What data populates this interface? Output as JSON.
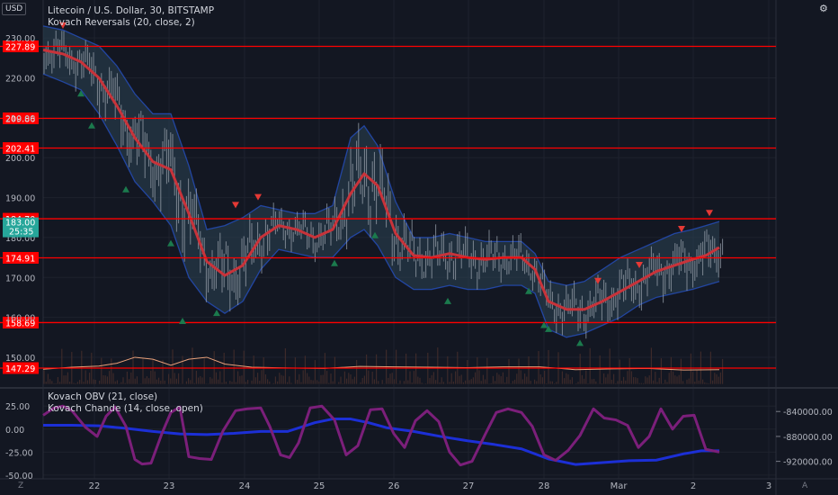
{
  "currency_badge": "USD",
  "title": "Litecoin / U.S. Dollar, 30, BITSTAMP",
  "indicators": {
    "reversals": "Kovach Reversals (20, close, 2)",
    "obv": "Kovach OBV (21, close)",
    "chande": "Kovach Chande (14, close, open)"
  },
  "corner_left": "Z",
  "corner_right": "A",
  "colors": {
    "background": "#131722",
    "grid": "#1e222d",
    "level_line": "#ff0000",
    "label_bg": "#ff0000",
    "ma_line": "#c8333a",
    "band_fill": "#2a4050",
    "band_edge": "#2962ff",
    "up_arrow": "#1b7a4d",
    "down_arrow": "#e53935",
    "obv_line": "#1c2fd6",
    "chande_line": "#7b1f7a",
    "price_tag": "#26a69a"
  },
  "chart_data": [
    {
      "type": "candlestick",
      "ylim": [
        143,
        235
      ],
      "xlim": [
        0,
        840
      ],
      "y_ticks": [
        150.0,
        160.0,
        170.0,
        180.0,
        190.0,
        200.0,
        210.0,
        220.0,
        230.0
      ],
      "y_tick_labels": [
        "150.00",
        "160.00",
        "170.00",
        "180.00",
        "190.00",
        "200.00",
        "210.00",
        "220.00",
        "230.00"
      ],
      "x_ticks": [
        105,
        188,
        272,
        355,
        438,
        521,
        605,
        688,
        771,
        855
      ],
      "x_tick_labels": [
        "22",
        "23",
        "24",
        "25",
        "26",
        "27",
        "28",
        "Mar",
        "2",
        "3"
      ],
      "horizontal_levels": [
        227.89,
        209.86,
        202.41,
        184.7,
        174.91,
        158.69,
        147.29
      ],
      "level_labels": [
        "227.89",
        "209.86",
        "202.41",
        "184.70",
        "174.91",
        "158.69",
        "147.29"
      ],
      "last_price": "183.00",
      "countdown": "25:35",
      "ma": {
        "x": [
          48,
          70,
          90,
          110,
          130,
          150,
          170,
          190,
          210,
          230,
          250,
          270,
          290,
          310,
          330,
          350,
          370,
          390,
          405,
          420,
          440,
          460,
          480,
          500,
          520,
          540,
          560,
          580,
          595,
          610,
          630,
          650,
          670,
          690,
          710,
          730,
          750,
          770,
          785,
          800
        ],
        "y": [
          227,
          226,
          224,
          220,
          213,
          205,
          199,
          197,
          186,
          174,
          170.5,
          173,
          180,
          183,
          182,
          180,
          182,
          191,
          196,
          193,
          181,
          175.5,
          175,
          176,
          175,
          174.5,
          175,
          175,
          172,
          164,
          162,
          162,
          164,
          166.5,
          169,
          171.5,
          173,
          174.5,
          175.5,
          177.5
        ]
      },
      "band": {
        "x": [
          48,
          70,
          90,
          110,
          130,
          150,
          170,
          190,
          210,
          230,
          250,
          270,
          290,
          310,
          330,
          350,
          370,
          390,
          405,
          420,
          440,
          460,
          480,
          500,
          520,
          540,
          560,
          580,
          595,
          610,
          630,
          650,
          670,
          690,
          710,
          730,
          750,
          770,
          785,
          800
        ],
        "upper": [
          233,
          232,
          230,
          228,
          223,
          216,
          211,
          211,
          198,
          182,
          183,
          185,
          188,
          187,
          186,
          186,
          188,
          205,
          208,
          203,
          189,
          180,
          180,
          181,
          180,
          179,
          179,
          179,
          176,
          169,
          168,
          169,
          172,
          175,
          177,
          179,
          181,
          182,
          183,
          184
        ],
        "lower": [
          221,
          219,
          217,
          211,
          203,
          194,
          189,
          183,
          170,
          164,
          161,
          164,
          172,
          177,
          176,
          175,
          175,
          180,
          182,
          178,
          170,
          167,
          167,
          168,
          167,
          167,
          168,
          168,
          166,
          157,
          155,
          156,
          158,
          160,
          163,
          165,
          166,
          167,
          168,
          169
        ]
      },
      "down_arrows": {
        "x": [
          70,
          262,
          287,
          665,
          711,
          758,
          789
        ],
        "y": [
          233,
          188,
          190,
          169,
          173,
          182,
          186
        ]
      },
      "up_arrows": {
        "x": [
          90,
          102,
          140,
          190,
          203,
          241,
          417,
          372,
          498,
          588,
          605,
          610,
          645
        ],
        "y": [
          216,
          208,
          192,
          178.5,
          159,
          161,
          180.5,
          173.5,
          164,
          166.5,
          158,
          157,
          153.5
        ]
      },
      "volume_line": {
        "x": [
          48,
          80,
          110,
          130,
          150,
          170,
          190,
          210,
          230,
          250,
          280,
          320,
          360,
          400,
          440,
          480,
          520,
          560,
          600,
          640,
          680,
          720,
          760,
          800
        ],
        "y": [
          147,
          147.5,
          147.8,
          148.5,
          150,
          149.5,
          148,
          149.5,
          150,
          148.3,
          147.5,
          147.3,
          147.2,
          147.7,
          147.6,
          147.5,
          147.4,
          147.6,
          147.6,
          146.9,
          147.1,
          147.2,
          146.8,
          146.9
        ]
      }
    },
    {
      "type": "line",
      "ylim": [
        -54,
        34
      ],
      "y2lim": [
        -948000,
        -818000
      ],
      "y_ticks": [
        25,
        0,
        -25,
        -50
      ],
      "y_tick_labels": [
        "25.00",
        "0.00",
        "-25.00",
        "-50.00"
      ],
      "y2_ticks": [
        -840000,
        -880000,
        -920000
      ],
      "y2_tick_labels": [
        "-840000.00",
        "-880000.00",
        "-920000.00"
      ],
      "series": [
        {
          "x": [
            48,
            80,
            110,
            140,
            170,
            200,
            230,
            260,
            290,
            320,
            350,
            370,
            390,
            410,
            430,
            460,
            490,
            520,
            550,
            580,
            610,
            640,
            670,
            700,
            730,
            760,
            780,
            800
          ],
          "y": [
            -862000,
            -862000,
            -863000,
            -867000,
            -872000,
            -876000,
            -877000,
            -875000,
            -872000,
            -872000,
            -858000,
            -852000,
            -852000,
            -858000,
            -866000,
            -872000,
            -880000,
            -887000,
            -893000,
            -900000,
            -916000,
            -925000,
            -922000,
            -919000,
            -918000,
            -908000,
            -903000,
            -903000
          ]
        },
        {
          "x": [
            48,
            60,
            70,
            80,
            95,
            108,
            118,
            128,
            140,
            150,
            158,
            168,
            180,
            190,
            200,
            210,
            222,
            235,
            248,
            262,
            275,
            290,
            300,
            312,
            322,
            332,
            345,
            358,
            372,
            385,
            398,
            412,
            425,
            438,
            450,
            462,
            475,
            488,
            500,
            512,
            525,
            540,
            552,
            565,
            580,
            592,
            605,
            618,
            632,
            645,
            660,
            672,
            685,
            698,
            710,
            722,
            735,
            748,
            760,
            772,
            785,
            800
          ],
          "y": [
            15,
            23,
            25,
            20,
            2,
            -8,
            14,
            24,
            3,
            -33,
            -38,
            -37,
            -5,
            18,
            24,
            -30,
            -32,
            -33,
            -2,
            20,
            22,
            23,
            3,
            -28,
            -31,
            -15,
            23,
            25,
            10,
            -28,
            -18,
            21,
            22,
            -5,
            -20,
            9,
            20,
            8,
            -25,
            -39,
            -35,
            -5,
            18,
            22,
            18,
            3,
            -28,
            -34,
            -23,
            -7,
            22,
            12,
            10,
            4,
            -20,
            -8,
            22,
            0,
            14,
            15,
            -22,
            -25
          ]
        }
      ]
    }
  ]
}
